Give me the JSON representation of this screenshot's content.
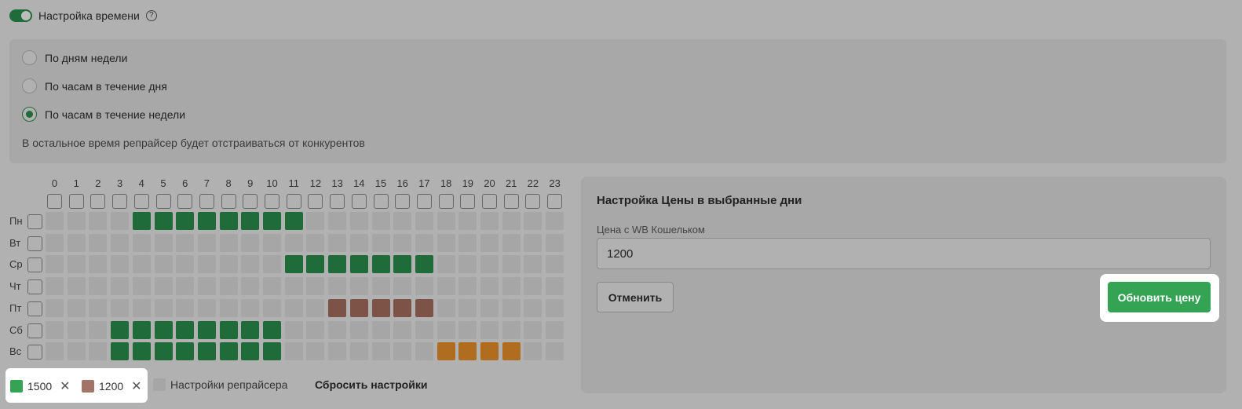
{
  "header": {
    "toggle_label": "Настройка времени",
    "help_symbol": "?"
  },
  "modes": {
    "options": [
      "По дням недели",
      "По часам в течение дня",
      "По часам в течение недели"
    ],
    "selected_index": 2,
    "hint": "В остальное время репрайсер будет отстраиваться от конкурентов"
  },
  "schedule": {
    "hours": [
      "0",
      "1",
      "2",
      "3",
      "4",
      "5",
      "6",
      "7",
      "8",
      "9",
      "10",
      "11",
      "12",
      "13",
      "14",
      "15",
      "16",
      "17",
      "18",
      "19",
      "20",
      "21",
      "22",
      "23"
    ],
    "days": [
      "Пн",
      "Вт",
      "Ср",
      "Чт",
      "Пт",
      "Сб",
      "Вс"
    ],
    "assignments": [
      {
        "day": 0,
        "from": 4,
        "to": 11,
        "price": "1500"
      },
      {
        "day": 2,
        "from": 11,
        "to": 17,
        "price": "1500"
      },
      {
        "day": 4,
        "from": 13,
        "to": 17,
        "price": "1200"
      },
      {
        "day": 5,
        "from": 3,
        "to": 10,
        "price": "1500"
      },
      {
        "day": 6,
        "from": 3,
        "to": 10,
        "price": "1500"
      },
      {
        "day": 6,
        "from": 18,
        "to": 21,
        "price": "other"
      }
    ]
  },
  "legend": {
    "items": [
      {
        "label": "1500",
        "color": "#34a354"
      },
      {
        "label": "1200",
        "color": "#a27467"
      }
    ],
    "remove_symbol": "✕",
    "repricer_label": "Настройки репрайсера",
    "repricer_color": "#a6a6a6",
    "reset_label": "Сбросить настройки"
  },
  "colors": {
    "1500": "#1f6b3a",
    "1200": "#7d5348",
    "other": "#b06d1f"
  },
  "price_panel": {
    "title": "Настройка Цены в выбранные дни",
    "field_label": "Цена с WB Кошельком",
    "field_value": "1200",
    "cancel_label": "Отменить",
    "update_label": "Обновить цену"
  }
}
